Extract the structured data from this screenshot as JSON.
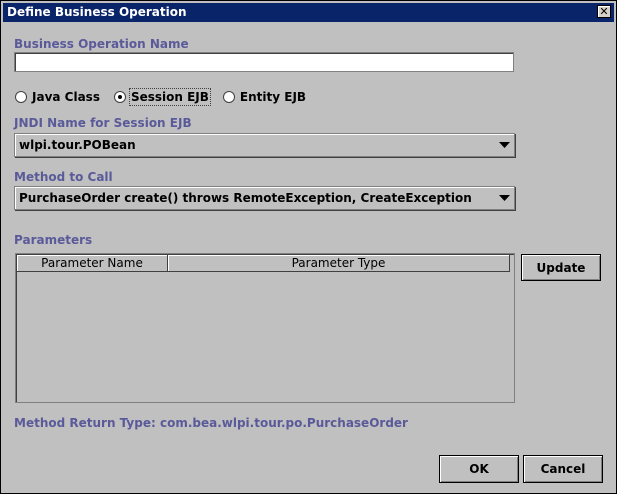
{
  "window": {
    "title": "Define Business Operation",
    "close_glyph": "✕"
  },
  "business_operation_name": {
    "label": "Business Operation Name",
    "value": "",
    "placeholder": ""
  },
  "implementation_type": {
    "options": [
      {
        "label": "Java Class",
        "selected": false
      },
      {
        "label": "Session EJB",
        "selected": true
      },
      {
        "label": "Entity EJB",
        "selected": false
      }
    ]
  },
  "jndi": {
    "label": "JNDI Name for Session EJB",
    "value": "wlpi.tour.POBean"
  },
  "method": {
    "label": "Method to Call",
    "value": "PurchaseOrder create() throws RemoteException, CreateException"
  },
  "parameters": {
    "label": "Parameters",
    "columns": [
      "Parameter Name",
      "Parameter Type"
    ],
    "rows": [],
    "update_label": "Update"
  },
  "return_type": {
    "text": "Method Return Type: com.bea.wlpi.tour.po.PurchaseOrder"
  },
  "buttons": {
    "ok_label": "OK",
    "cancel_label": "Cancel"
  },
  "colors": {
    "title_bar": "#0a246a",
    "dialog_bg": "#c0c0c0",
    "label_accent": "#5a5a9a"
  }
}
